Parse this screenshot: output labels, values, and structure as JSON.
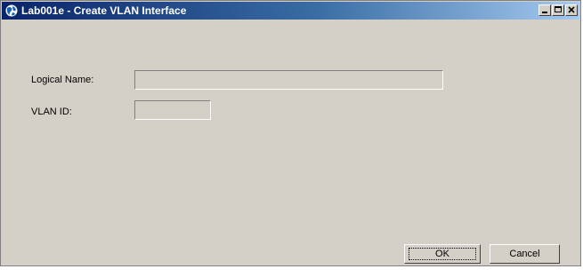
{
  "window": {
    "title": "Lab001e - Create VLAN Interface",
    "icon": "globe-icon",
    "controls": {
      "minimize": "minimize-icon",
      "maximize": "maximize-icon",
      "close": "close-icon"
    }
  },
  "form": {
    "logical_name": {
      "label": "Logical Name:",
      "value": ""
    },
    "vlan_id": {
      "label": "VLAN ID:",
      "value": ""
    }
  },
  "buttons": {
    "ok": "OK",
    "cancel": "Cancel"
  },
  "colors": {
    "titlebar_start": "#0a246a",
    "titlebar_end": "#a6caf0",
    "face": "#d4d0c8"
  }
}
